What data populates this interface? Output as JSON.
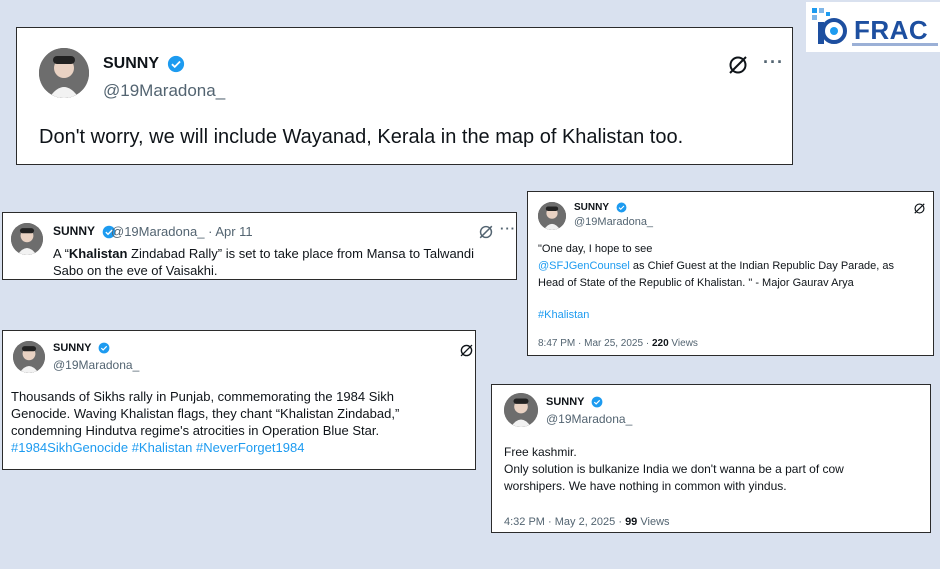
{
  "logo": {
    "text": "FRAC"
  },
  "tweets": [
    {
      "name": "SUNNY",
      "handle": "@19Maradona_",
      "text": "Don't worry, we will include Wayanad, Kerala in the map of Khalistan too."
    },
    {
      "name": "SUNNY",
      "handle": "@19Maradona_",
      "dot": "·",
      "date": "Apr 11",
      "text_a": "A “",
      "text_bold": "Khalistan",
      "text_b": " Zindabad Rally” is set to take place from Mansa to Talwandi",
      "text_line2": "Sabo on the eve of Vaisakhi."
    },
    {
      "name": "SUNNY",
      "handle": "@19Maradona_",
      "line1": "\"One day, I hope to see",
      "mention": "@SFJGenCounsel",
      "line2_rest": " as Chief Guest at the Indian Republic Day Parade, as",
      "line3": "Head of State of the Republic of Khalistan. \" - Major Gaurav Arya",
      "hashtag": "#Khalistan",
      "time": "8:47 PM · Mar 25, 2025 ·",
      "views_count": "220",
      "views_label": "Views"
    },
    {
      "name": "SUNNY",
      "handle": "@19Maradona_",
      "line1": "Thousands of Sikhs rally in Punjab, commemorating the 1984 Sikh",
      "line2": "Genocide. Waving Khalistan flags, they chant “Khalistan Zindabad,”",
      "line3": "condemning Hindutva regime's atrocities in Operation Blue Star.",
      "hashtags": "#1984SikhGenocide #Khalistan #NeverForget1984"
    },
    {
      "name": "SUNNY",
      "handle": "@19Maradona_",
      "line1": "Free kashmir.",
      "line2": "Only solution is bulkanize India we don't wanna be a part of cow",
      "line3": "worshipers. We have nothing in common with yindus.",
      "time": "4:32 PM · May 2, 2025 ·",
      "views_count": "99",
      "views_label": "Views"
    }
  ],
  "colors": {
    "background": "#d9e1ef",
    "link": "#1d9bf0",
    "verified": "#1d9bf0",
    "muted": "#536471"
  }
}
